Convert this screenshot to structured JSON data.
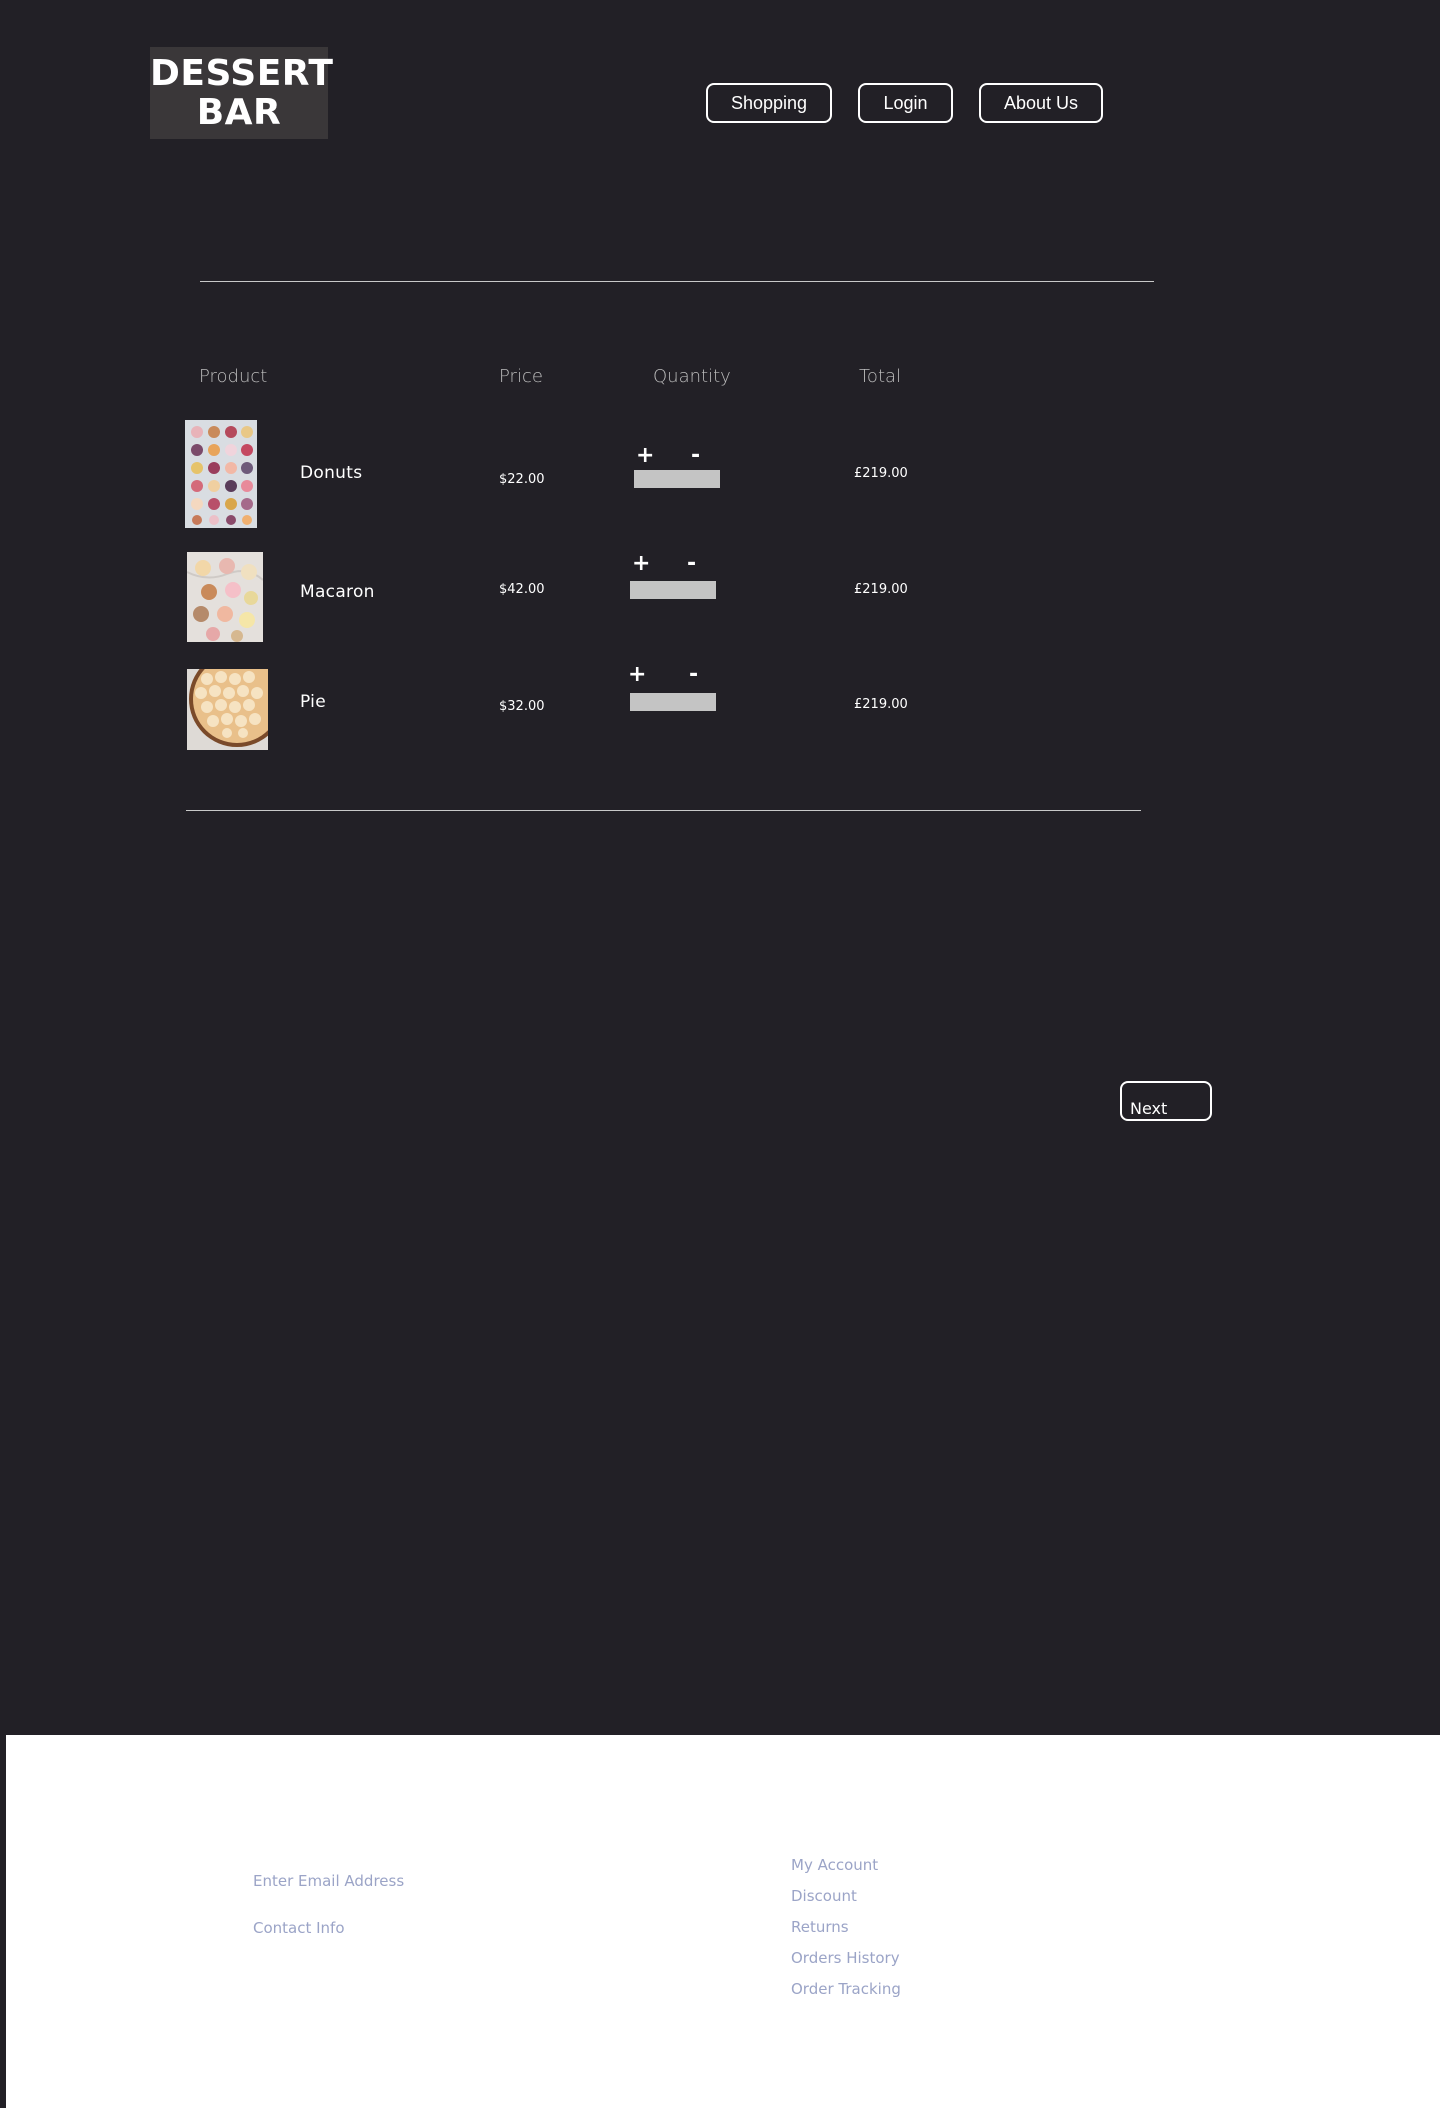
{
  "header": {
    "logo_line1": "DESSERT",
    "logo_line2": "BAR",
    "nav": {
      "shopping": "Shopping",
      "login": "Login",
      "about": "About Us"
    }
  },
  "cart": {
    "columns": {
      "product": "Product",
      "price": "Price",
      "quantity": "Quantity",
      "total": "Total"
    },
    "items": [
      {
        "name": "Donuts",
        "price": "$22.00",
        "plus": "+",
        "minus": "-",
        "total": "£219.00",
        "image": "donuts-photo"
      },
      {
        "name": "Macaron",
        "price": "$42.00",
        "plus": "+",
        "minus": "-",
        "total": "£219.00",
        "image": "macarons-photo"
      },
      {
        "name": "Pie",
        "price": "$32.00",
        "plus": "+",
        "minus": "-",
        "total": "£219.00",
        "image": "pie-photo"
      }
    ],
    "next_label": "Next"
  },
  "footer": {
    "email_placeholder": "Enter Email Address",
    "contact": "Contact Info",
    "links": [
      "My Account",
      "Discount",
      "Returns",
      "Orders History",
      "Order Tracking"
    ]
  },
  "colors": {
    "background": "#222026",
    "footer_bg": "#ffffff",
    "footer_text": "#9ba4c7",
    "qty_field": "#c4c4c4"
  }
}
